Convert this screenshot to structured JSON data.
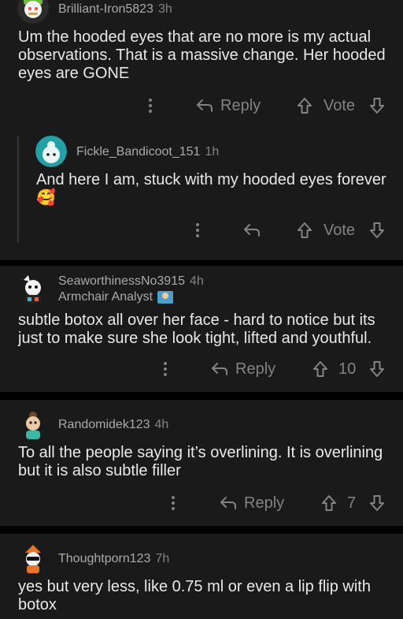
{
  "comments": [
    {
      "author": "Brilliant-Iron5823",
      "time": "3h",
      "text": "Um the hooded eyes that are no more is my actual observations. That is a massive change. Her hooded eyes are GONE",
      "reply_label": "Reply",
      "vote_label": "Vote"
    },
    {
      "author": "Fickle_Bandicoot_151",
      "time": "1h",
      "text": "And here I am, stuck with my hooded eyes forever",
      "emoji": "🥰",
      "vote_label": "Vote"
    },
    {
      "author": "SeaworthinessNo3915",
      "time": "4h",
      "flair": "Armchair Analyst",
      "text": "subtle botox all over her face - hard to notice but its just to make sure she look tight, lifted and youthful.",
      "reply_label": "Reply",
      "vote_count": "10"
    },
    {
      "author": "Randomidek123",
      "time": "4h",
      "text": "To all the people saying it’s overlining. It is overlining but it is also subtle filler",
      "reply_label": "Reply",
      "vote_count": "7"
    },
    {
      "author": "Thoughtporn123",
      "time": "7h",
      "text": "yes but very less, like 0.75 ml or even a lip flip with botox"
    }
  ],
  "colors": {
    "background": "#000000",
    "card": "#1a1a1b",
    "text": "#e7e9ea",
    "muted": "#818384",
    "thread_line": "#343536"
  }
}
